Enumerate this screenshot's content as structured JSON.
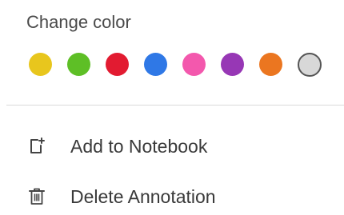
{
  "color_section": {
    "title": "Change color",
    "swatches": [
      {
        "name": "yellow",
        "color": "#e8c61d"
      },
      {
        "name": "green",
        "color": "#5ebf26"
      },
      {
        "name": "red",
        "color": "#e21b31"
      },
      {
        "name": "blue",
        "color": "#2f78e6"
      },
      {
        "name": "pink",
        "color": "#f358ad"
      },
      {
        "name": "purple",
        "color": "#9737b5"
      },
      {
        "name": "orange",
        "color": "#eb7620"
      },
      {
        "name": "gray",
        "color": "#d8d8d8",
        "outline_color": "#555555"
      }
    ]
  },
  "menu_items": [
    {
      "label": "Add to Notebook",
      "icon": "add-to-notebook-icon"
    },
    {
      "label": "Delete Annotation",
      "icon": "trash-icon"
    }
  ]
}
